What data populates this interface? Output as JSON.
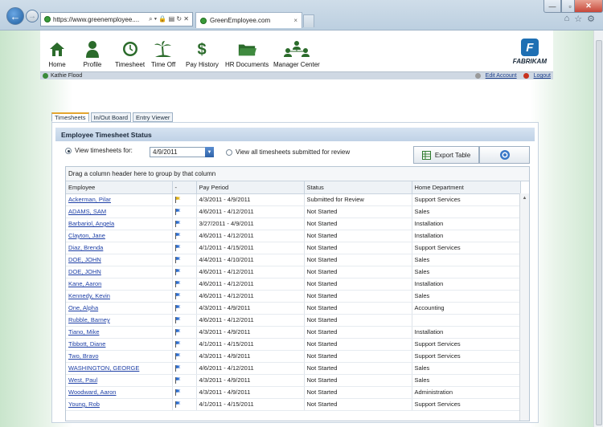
{
  "browser": {
    "url": "https://www.greenemployee....",
    "addr_controls": "⌕ ▾ 🔒 ▤ ↻ ✕",
    "tab_title": "GreenEmployee.com",
    "tab_close": "×",
    "window": {
      "min": "—",
      "max": "▫",
      "close": "✕"
    },
    "tools": [
      "⌂",
      "☆",
      "⚙"
    ]
  },
  "nav": {
    "items": [
      {
        "label": "Home",
        "icon": "home-icon"
      },
      {
        "label": "Profile",
        "icon": "profile-icon"
      },
      {
        "label": "Timesheet",
        "icon": "clock-icon"
      },
      {
        "label": "Time Off",
        "icon": "palm-tree-icon"
      },
      {
        "label": "Pay History",
        "icon": "dollar-icon"
      },
      {
        "label": "HR Documents",
        "icon": "folder-icon"
      },
      {
        "label": "Manager Center",
        "icon": "team-icon"
      }
    ],
    "brand_name": "FABRIKAM"
  },
  "userbar": {
    "user_name": "Kathie Flood",
    "edit_account": "Edit Account",
    "logout": "Logout"
  },
  "tabs": [
    "Timesheets",
    "In/Out Board",
    "Entry Viewer"
  ],
  "panel": {
    "title": "Employee Timesheet Status",
    "view_for_label": "View timesheets for:",
    "date_value": "4/9/2011",
    "view_all_label": "View all timesheets submitted for review",
    "export_label": "Export Table",
    "group_hint": "Drag a column header here to group by that column"
  },
  "grid": {
    "columns": [
      "Employee",
      "-",
      "Pay Period",
      "Status",
      "Home Department"
    ],
    "rows": [
      {
        "employee": "Ackerman, Pilar",
        "flag": "yellow",
        "period": "4/3/2011 - 4/9/2011",
        "status": "Submitted for Review",
        "dept": "Support Services"
      },
      {
        "employee": "ADAMS, SAM",
        "flag": "blue",
        "period": "4/6/2011 - 4/12/2011",
        "status": "Not Started",
        "dept": "Sales"
      },
      {
        "employee": "Barbariol, Angela",
        "flag": "blue",
        "period": "3/27/2011 - 4/9/2011",
        "status": "Not Started",
        "dept": "Installation"
      },
      {
        "employee": "Clayton, Jane",
        "flag": "blue",
        "period": "4/6/2011 - 4/12/2011",
        "status": "Not Started",
        "dept": "Installation"
      },
      {
        "employee": "Diaz, Brenda",
        "flag": "blue",
        "period": "4/1/2011 - 4/15/2011",
        "status": "Not Started",
        "dept": "Support Services"
      },
      {
        "employee": "DOE, JOHN",
        "flag": "blue",
        "period": "4/4/2011 - 4/10/2011",
        "status": "Not Started",
        "dept": "Sales"
      },
      {
        "employee": "DOE, JOHN",
        "flag": "blue",
        "period": "4/6/2011 - 4/12/2011",
        "status": "Not Started",
        "dept": "Sales"
      },
      {
        "employee": "Kane, Aaron",
        "flag": "blue",
        "period": "4/6/2011 - 4/12/2011",
        "status": "Not Started",
        "dept": "Installation"
      },
      {
        "employee": "Kennedy, Kevin",
        "flag": "blue",
        "period": "4/6/2011 - 4/12/2011",
        "status": "Not Started",
        "dept": "Sales"
      },
      {
        "employee": "One, Alpha",
        "flag": "blue",
        "period": "4/3/2011 - 4/9/2011",
        "status": "Not Started",
        "dept": "Accounting"
      },
      {
        "employee": "Rubble, Barney",
        "flag": "blue",
        "period": "4/6/2011 - 4/12/2011",
        "status": "Not Started",
        "dept": ""
      },
      {
        "employee": "Tiano, Mike",
        "flag": "blue",
        "period": "4/3/2011 - 4/9/2011",
        "status": "Not Started",
        "dept": "Installation"
      },
      {
        "employee": "Tibbott, Diane",
        "flag": "blue",
        "period": "4/1/2011 - 4/15/2011",
        "status": "Not Started",
        "dept": "Support Services"
      },
      {
        "employee": "Two, Bravo",
        "flag": "blue",
        "period": "4/3/2011 - 4/9/2011",
        "status": "Not Started",
        "dept": "Support Services"
      },
      {
        "employee": "WASHINGTON, GEORGE",
        "flag": "blue",
        "period": "4/6/2011 - 4/12/2011",
        "status": "Not Started",
        "dept": "Sales"
      },
      {
        "employee": "West, Paul",
        "flag": "blue",
        "period": "4/3/2011 - 4/9/2011",
        "status": "Not Started",
        "dept": "Sales"
      },
      {
        "employee": "Woodward, Aaron",
        "flag": "blue",
        "period": "4/3/2011 - 4/9/2011",
        "status": "Not Started",
        "dept": "Administration"
      },
      {
        "employee": "Young, Rob",
        "flag": "blue",
        "period": "4/1/2011 - 4/15/2011",
        "status": "Not Started",
        "dept": "Support Services"
      }
    ]
  },
  "colors": {
    "flag_yellow": "#e0b21a",
    "flag_blue": "#2f6fd0",
    "accent": "#2e62a8"
  }
}
